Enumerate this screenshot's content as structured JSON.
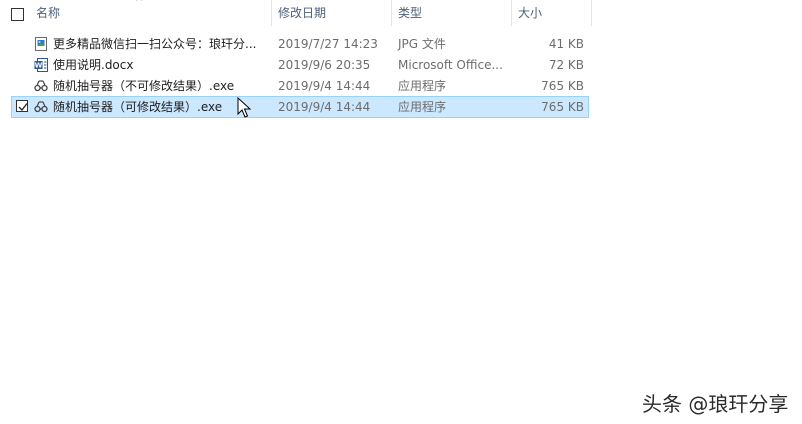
{
  "header": {
    "name": "名称",
    "date": "修改日期",
    "type": "类型",
    "size": "大小"
  },
  "files": [
    {
      "name": "更多精品微信扫一扫公众号：琅玕分...",
      "date": "2019/7/27 14:23",
      "type": "JPG 文件",
      "size": "41 KB",
      "icon": "jpg-image-icon",
      "selected": false
    },
    {
      "name": "使用说明.docx",
      "date": "2019/9/6 20:35",
      "type": "Microsoft Office...",
      "size": "72 KB",
      "icon": "word-document-icon",
      "selected": false
    },
    {
      "name": "随机抽号器（不可修改结果）.exe",
      "date": "2019/9/4 14:44",
      "type": "应用程序",
      "size": "765 KB",
      "icon": "exe-app-icon",
      "selected": false
    },
    {
      "name": "随机抽号器（可修改结果）.exe",
      "date": "2019/9/4 14:44",
      "type": "应用程序",
      "size": "765 KB",
      "icon": "exe-app-icon",
      "selected": true
    }
  ],
  "watermark": "头条 @琅玕分享",
  "colors": {
    "selection": "#cce8ff",
    "selection_border": "#99d1ff",
    "header_text": "#4c607a"
  }
}
